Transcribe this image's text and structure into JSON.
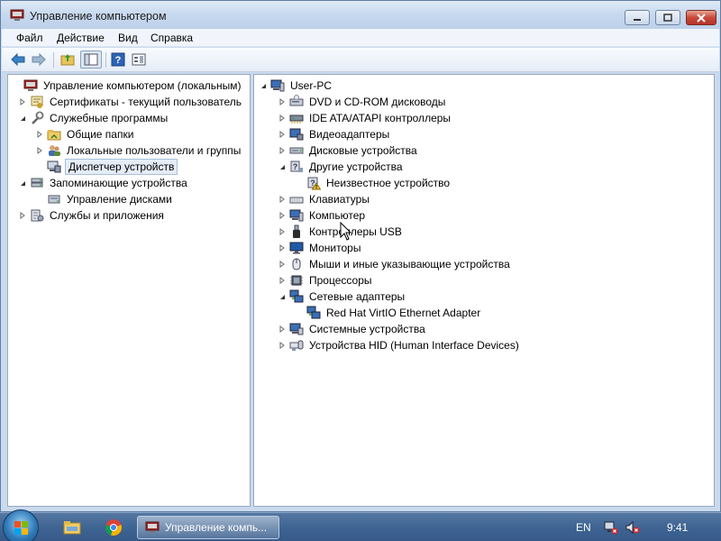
{
  "window": {
    "title": "Управление компьютером",
    "menu": [
      "Файл",
      "Действие",
      "Вид",
      "Справка"
    ]
  },
  "left_tree": [
    {
      "label": "Управление компьютером (локальным)",
      "icon": "computer-management-icon",
      "expander": ""
    },
    {
      "label": "Сертификаты - текущий пользователь",
      "icon": "certificates-icon",
      "expander": "▷"
    },
    {
      "label": "Служебные программы",
      "icon": "system-tools-icon",
      "expander": "◢"
    },
    {
      "label": "Общие папки",
      "icon": "shared-folders-icon",
      "expander": "▷"
    },
    {
      "label": "Локальные пользователи и группы",
      "icon": "users-icon",
      "expander": "▷"
    },
    {
      "label": "Диспетчер устройств",
      "icon": "device-manager-icon",
      "expander": "",
      "selected": true
    },
    {
      "label": "Запоминающие устройства",
      "icon": "storage-icon",
      "expander": "◢"
    },
    {
      "label": "Управление дисками",
      "icon": "disk-management-icon",
      "expander": ""
    },
    {
      "label": "Службы и приложения",
      "icon": "services-icon",
      "expander": "▷"
    }
  ],
  "device_tree": [
    {
      "label": "User-PC",
      "icon": "computer-icon",
      "expander": "◢"
    },
    {
      "label": "DVD и CD-ROM дисководы",
      "icon": "dvd-drive-icon",
      "expander": "▷"
    },
    {
      "label": "IDE ATA/ATAPI контроллеры",
      "icon": "ide-controller-icon",
      "expander": "▷"
    },
    {
      "label": "Видеоадаптеры",
      "icon": "display-adapter-icon",
      "expander": "▷"
    },
    {
      "label": "Дисковые устройства",
      "icon": "disk-drive-icon",
      "expander": "▷"
    },
    {
      "label": "Другие устройства",
      "icon": "other-devices-icon",
      "expander": "◢"
    },
    {
      "label": "Неизвестное устройство",
      "icon": "unknown-device-warning-icon",
      "expander": ""
    },
    {
      "label": "Клавиатуры",
      "icon": "keyboard-icon",
      "expander": "▷"
    },
    {
      "label": "Компьютер",
      "icon": "computer-icon",
      "expander": "▷"
    },
    {
      "label": "Контроллеры USB",
      "icon": "usb-icon",
      "expander": "▷"
    },
    {
      "label": "Мониторы",
      "icon": "monitor-icon",
      "expander": "▷"
    },
    {
      "label": "Мыши и иные указывающие устройства",
      "icon": "mouse-icon",
      "expander": "▷"
    },
    {
      "label": "Процессоры",
      "icon": "processor-icon",
      "expander": "▷"
    },
    {
      "label": "Сетевые адаптеры",
      "icon": "network-adapter-icon",
      "expander": "◢"
    },
    {
      "label": "Red Hat VirtIO Ethernet Adapter",
      "icon": "network-adapter-icon",
      "expander": ""
    },
    {
      "label": "Системные устройства",
      "icon": "system-devices-icon",
      "expander": "▷"
    },
    {
      "label": "Устройства HID (Human Interface Devices)",
      "icon": "hid-icon",
      "expander": "▷"
    }
  ],
  "taskbar": {
    "active_app_label": "Управление компь...",
    "language": "EN",
    "time": "9:41"
  },
  "colors": {
    "selection_bg": "#e4ecf7",
    "taskbar": "#3f6593",
    "close_button": "#c8493a"
  }
}
